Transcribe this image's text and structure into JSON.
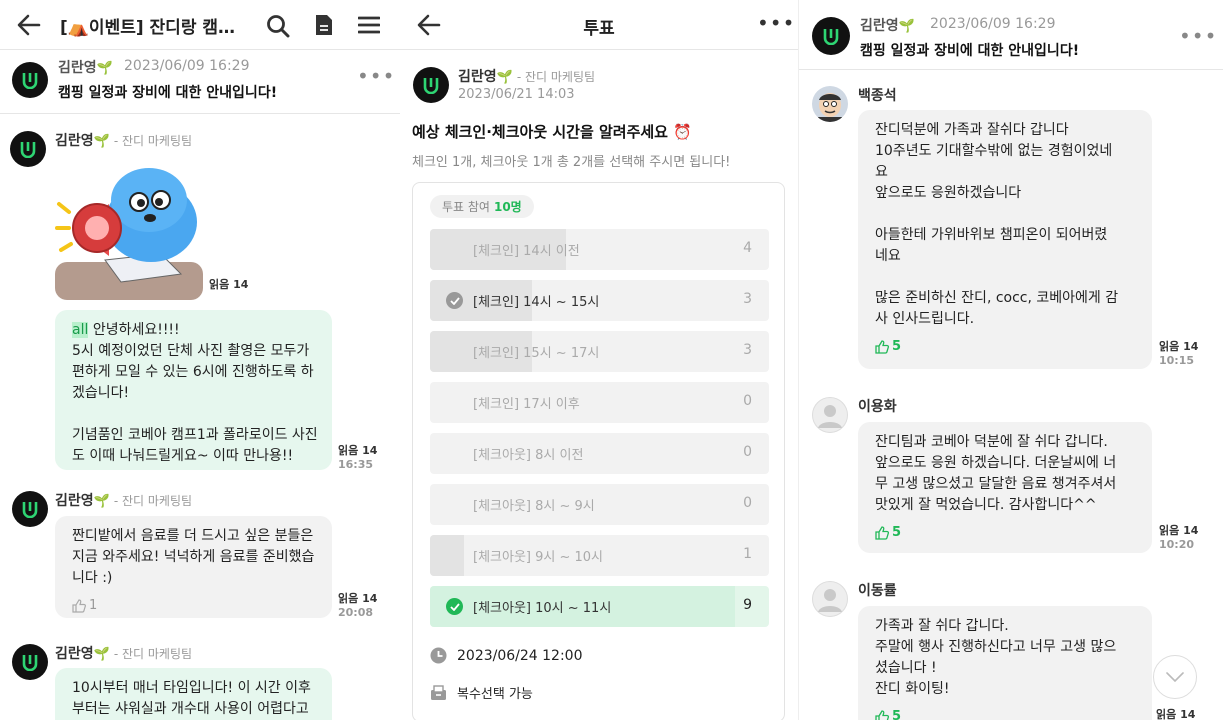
{
  "left": {
    "title": "[⛺이벤트] 잔디랑 캠…",
    "notice": {
      "name": "김란영",
      "time": "2023/06/09 16:29",
      "text": "캠핑 일정과 장비에 대한 안내입니다!"
    },
    "messages": [
      {
        "name": "김란영",
        "team": "- 잔디 마케팅팀",
        "sticker_read": "읽음 14"
      },
      {
        "lines": [
          "안녕하세요!!!!",
          "5시 예정이었던 단체 사진 촬영은 모두가",
          "편하게 모일 수 있는 6시에 진행하도록 하",
          "겠습니다!",
          "",
          "기념품인 코베아 캠프1과 폴라로이드 사진",
          "도 이때 나눠드릴게요~ 이따 만나용!!"
        ],
        "mention": "all",
        "read": "읽음 14",
        "time": "16:35"
      },
      {
        "name": "김란영",
        "team": "- 잔디 마케팅팀",
        "lines": [
          "짠디밭에서 음료를 더 드시고 싶은 분들은",
          "지금 와주세요! 넉넉하게 음료를 준비했습",
          "니다 :)"
        ],
        "likes": "1",
        "read": "읽음 14",
        "time": "20:08"
      },
      {
        "name": "김란영",
        "team": "- 잔디 마케팅팀",
        "lines": [
          "10시부터 매너 타임입니다! 이 시간 이후",
          "부터는 샤워실과 개수대 사용이 어렵다고"
        ]
      }
    ]
  },
  "poll": {
    "header": "투표",
    "name": "김란영",
    "team": "- 잔디 마케팅팀",
    "time": "2023/06/21 14:03",
    "title": "예상 체크인·체크아웃 시간을 알려주세요 ⏰",
    "desc": "체크인 1개, 체크아웃 1개 총 2개를 선택해 주시면 됩니다!",
    "participants_label": "투표 참여",
    "participants": "10명",
    "options": [
      {
        "label": "[체크인] 14시 이전",
        "count": "4",
        "share": 0.4
      },
      {
        "label": "[체크인] 14시 ~ 15시",
        "count": "3",
        "share": 0.3,
        "selected": true
      },
      {
        "label": "[체크인] 15시 ~ 17시",
        "count": "3",
        "share": 0.3
      },
      {
        "label": "[체크인] 17시 이후",
        "count": "0",
        "share": 0
      },
      {
        "label": "[체크아웃] 8시 이전",
        "count": "0",
        "share": 0
      },
      {
        "label": "[체크아웃] 8시 ~ 9시",
        "count": "0",
        "share": 0
      },
      {
        "label": "[체크아웃] 9시 ~ 10시",
        "count": "1",
        "share": 0.1
      },
      {
        "label": "[체크아웃] 10시 ~ 11시",
        "count": "9",
        "share": 0.9,
        "selected": true,
        "winner": true
      }
    ],
    "deadline": "2023/06/24 12:00",
    "multi": "복수선택 가능"
  },
  "right": {
    "notice": {
      "name": "김란영",
      "time": "2023/06/09 16:29",
      "text": "캠핑 일정과 장비에 대한 안내입니다!"
    },
    "comments": [
      {
        "name": "백종석",
        "lines": [
          "잔디덕분에 가족과 잘쉬다 갑니다",
          "10주년도 기대할수밖에  없는 경험이었네",
          "요",
          "앞으로도 응원하겠습니다",
          "",
          "아들한테 가위바위보 챔피온이 되어버렸",
          "네요",
          "",
          "많은 준비하신 잔디, cocc, 코베아에게 감",
          "사 인사드립니다."
        ],
        "likes": "5",
        "read": "읽음 14",
        "time": "10:15"
      },
      {
        "name": "이용화",
        "lines": [
          "잔디팀과 코베아 덕분에 잘 쉬다 갑니다.",
          "앞으로도 응원 하겠습니다. 더운날씨에 너",
          "무 고생 많으셨고 달달한 음료 챙겨주셔서",
          "맛있게 잘 먹었습니다. 감사합니다^^"
        ],
        "likes": "5",
        "read": "읽음 14",
        "time": "10:20"
      },
      {
        "name": "이동률",
        "lines": [
          "가족과 잘 쉬다 갑니다.",
          "주말에 행사 진행하신다고 너무 고생 많으",
          "셨습니다 !",
          "잔디 화이팅!"
        ],
        "likes": "5",
        "read": "읽음 14"
      }
    ]
  },
  "colors": {
    "accent": "#20b857",
    "bubble_green": "#e6f7ee",
    "bubble_gray": "#f2f2f2"
  }
}
